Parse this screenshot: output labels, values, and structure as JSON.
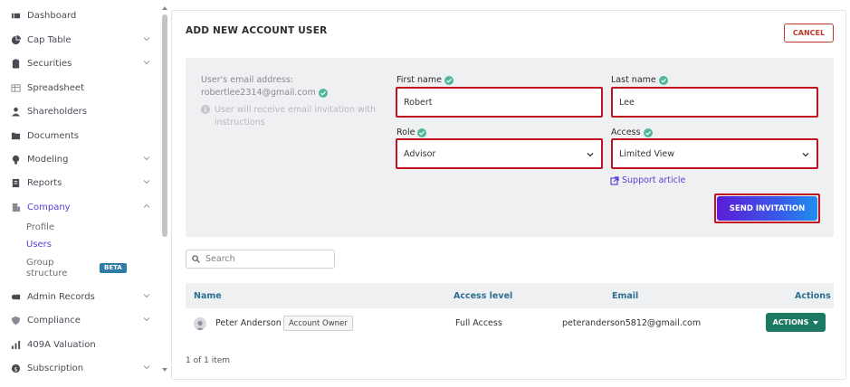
{
  "sidebar": {
    "items": [
      {
        "label": "Dashboard",
        "icon": "dashboard-icon"
      },
      {
        "label": "Cap Table",
        "icon": "pie-chart-icon"
      },
      {
        "label": "Securities",
        "icon": "clipboard-icon"
      },
      {
        "label": "Spreadsheet",
        "icon": "spreadsheet-icon"
      },
      {
        "label": "Shareholders",
        "icon": "user-icon"
      },
      {
        "label": "Documents",
        "icon": "folder-icon"
      },
      {
        "label": "Modeling",
        "icon": "bulb-icon"
      },
      {
        "label": "Reports",
        "icon": "report-icon"
      },
      {
        "label": "Company",
        "icon": "building-icon"
      },
      {
        "label": "Admin Records",
        "icon": "records-icon"
      },
      {
        "label": "Compliance",
        "icon": "shield-icon"
      },
      {
        "label": "409A Valuation",
        "icon": "valuation-icon"
      },
      {
        "label": "Subscription",
        "icon": "dollar-icon"
      }
    ],
    "company_sub": {
      "profile": "Profile",
      "users": "Users",
      "group_line1": "Group",
      "group_line2": "structure",
      "beta": "BETA"
    }
  },
  "page": {
    "title": "ADD NEW ACCOUNT USER",
    "cancel": "CANCEL"
  },
  "form": {
    "email_label": "User's email address:",
    "email_value": "robertlee2314@gmail.com",
    "hint_line1": "User will receive email invitation with",
    "hint_line2": "instructions",
    "first_name_label": "First name",
    "first_name_value": "Robert",
    "last_name_label": "Last name",
    "last_name_value": "Lee",
    "role_label": "Role",
    "role_value": "Advisor",
    "access_label": "Access",
    "access_value": "Limited View",
    "support_link": "Support article",
    "send_button": "SEND INVITATION"
  },
  "search": {
    "placeholder": "Search"
  },
  "table": {
    "headers": {
      "name": "Name",
      "access": "Access level",
      "email": "Email",
      "actions": "Actions"
    },
    "rows": [
      {
        "name": "Peter Anderson",
        "badge": "Account Owner",
        "access": "Full Access",
        "email": "peteranderson5812@gmail.com",
        "action": "ACTIONS"
      }
    ],
    "count": "1 of 1 item"
  },
  "colors": {
    "accent_purple": "#5a3fd6",
    "highlight_red": "#c1121f",
    "cancel_red": "#c0392b",
    "actions_green": "#1d7a62",
    "header_blue": "#2d6f8f",
    "check_teal": "#52b69a"
  }
}
